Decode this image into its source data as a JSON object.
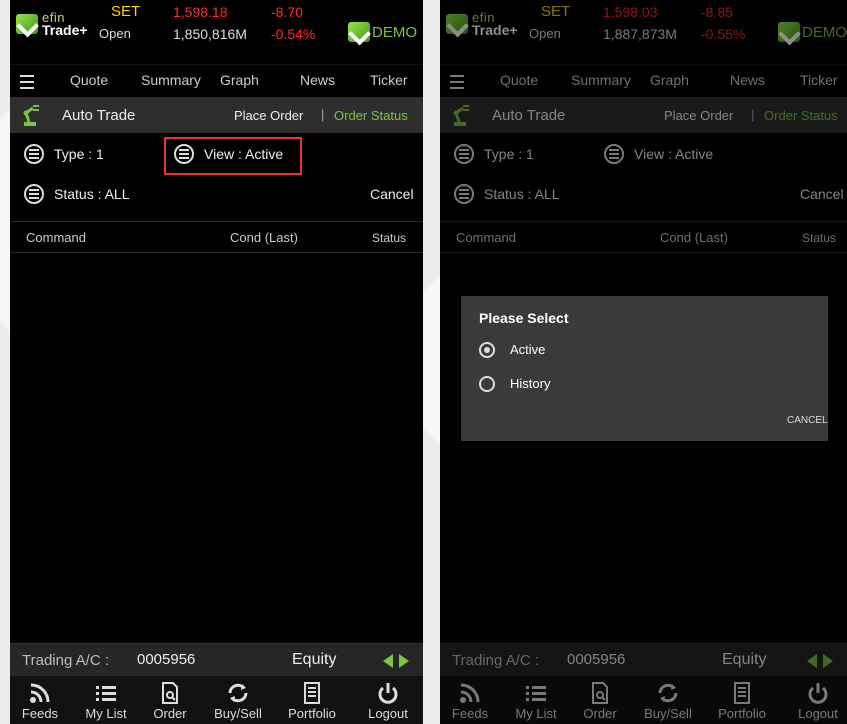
{
  "colors": {
    "accent_green": "#7dc241",
    "value_red": "#ff2a2a",
    "set_yellow": "#ffd200",
    "highlight_red": "#e33333"
  },
  "left": {
    "logo": {
      "line1": "efin",
      "line2": "Trade+"
    },
    "market": {
      "index_name": "SET",
      "index_value": "1,598.18",
      "change": "-8.70",
      "session": "Open",
      "volume": "1,850,816M",
      "change_pct": "-0.54%"
    },
    "demo_label": "DEMO",
    "nav": [
      "Quote",
      "Summary",
      "Graph",
      "News",
      "Ticker"
    ],
    "section": {
      "title": "Auto Trade",
      "place_order": "Place Order",
      "separator": "|",
      "order_status": "Order Status"
    },
    "filters": {
      "type": "Type : 1",
      "view": "View : Active",
      "status": "Status : ALL",
      "cancel": "Cancel"
    },
    "table_headers": {
      "command": "Command",
      "cond": "Cond (Last)",
      "status": "Status"
    },
    "account": {
      "label": "Trading A/C :",
      "number": "0005956",
      "type": "Equity"
    },
    "tabs": [
      "Feeds",
      "My List",
      "Order",
      "Buy/Sell",
      "Portfolio",
      "Logout"
    ]
  },
  "right": {
    "logo": {
      "line1": "efin",
      "line2": "Trade+"
    },
    "market": {
      "index_name": "SET",
      "index_value": "1,598.03",
      "change": "-8.85",
      "session": "Open",
      "volume": "1,887,873M",
      "change_pct": "-0.55%"
    },
    "demo_label": "DEMO",
    "nav": [
      "Quote",
      "Summary",
      "Graph",
      "News",
      "Ticker"
    ],
    "section": {
      "title": "Auto Trade",
      "place_order": "Place Order",
      "separator": "|",
      "order_status": "Order Status"
    },
    "filters": {
      "type": "Type : 1",
      "view": "View : Active",
      "status": "Status : ALL",
      "cancel": "Cancel"
    },
    "table_headers": {
      "command": "Command",
      "cond": "Cond (Last)",
      "status": "Status"
    },
    "account": {
      "label": "Trading A/C :",
      "number": "0005956",
      "type": "Equity"
    },
    "tabs": [
      "Feeds",
      "My List",
      "Order",
      "Buy/Sell",
      "Portfolio",
      "Logout"
    ],
    "dialog": {
      "title": "Please Select",
      "options": [
        "Active",
        "History"
      ],
      "selected": "Active",
      "cancel": "CANCEL"
    }
  }
}
